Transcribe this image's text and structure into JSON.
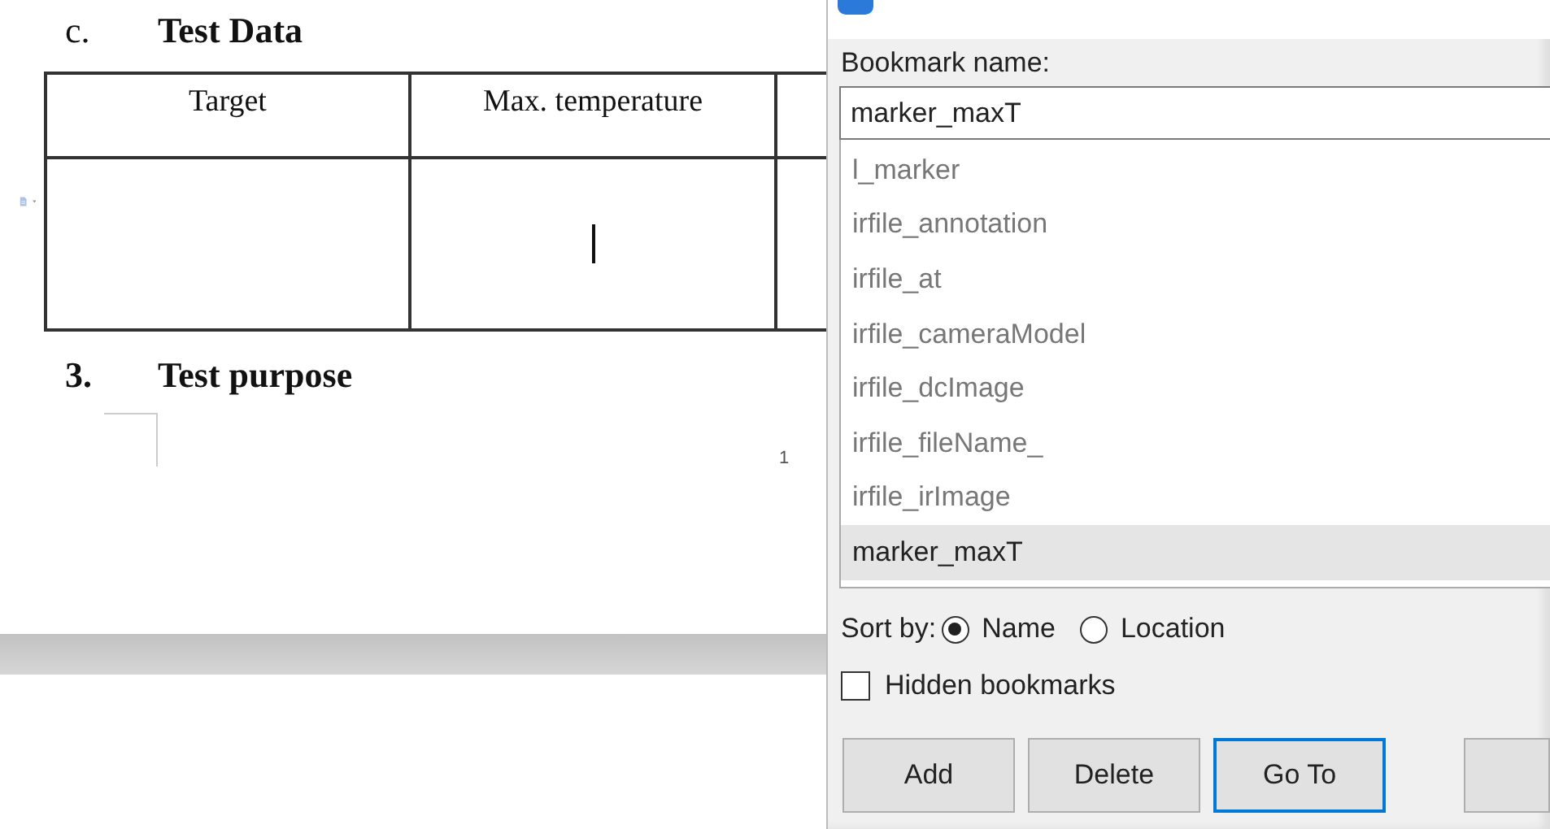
{
  "document": {
    "heading": {
      "number": "c.",
      "title": "Test Data"
    },
    "table": {
      "columns": [
        "Target",
        "Max. temperature"
      ]
    },
    "section": {
      "number": "3.",
      "title": "Test purpose"
    },
    "page_number": "1"
  },
  "dialog": {
    "name_label": "Bookmark name:",
    "name_value": "marker_maxT",
    "bookmarks": [
      {
        "label": "l_marker",
        "selected": false
      },
      {
        "label": "irfile_annotation",
        "selected": false
      },
      {
        "label": "irfile_at",
        "selected": false
      },
      {
        "label": "irfile_cameraModel",
        "selected": false
      },
      {
        "label": "irfile_dcImage",
        "selected": false
      },
      {
        "label": "irfile_fileName_",
        "selected": false
      },
      {
        "label": "irfile_irImage",
        "selected": false
      },
      {
        "label": "marker_maxT",
        "selected": true
      }
    ],
    "sort_label": "Sort by:",
    "sort_options": [
      {
        "label": "Name",
        "selected": true
      },
      {
        "label": "Location",
        "selected": false
      }
    ],
    "hidden_bookmarks": {
      "label": "Hidden bookmarks",
      "checked": false
    },
    "buttons": [
      {
        "label": "Add",
        "default": false
      },
      {
        "label": "Delete",
        "default": false
      },
      {
        "label": "Go To",
        "default": true
      }
    ]
  }
}
